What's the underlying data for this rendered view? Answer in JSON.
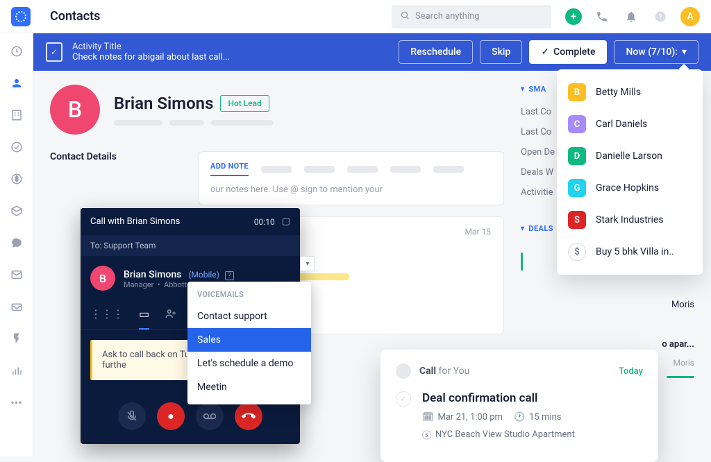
{
  "header": {
    "title": "Contacts",
    "search_placeholder": "Search anything",
    "avatar_letter": "A"
  },
  "activity": {
    "label": "Activity Title",
    "description": "Check notes for abigail about last call...",
    "reschedule": "Reschedule",
    "skip": "Skip",
    "complete": "Complete",
    "now": "Now (7/10):"
  },
  "contact": {
    "initial": "B",
    "name": "Brian Simons",
    "badge": "Hot Lead"
  },
  "details_title": "Contact Details",
  "note": {
    "tab": "ADD NOTE",
    "placeholder": "our notes here. Use @ sign to mention your"
  },
  "timeline": {
    "date": "Mar 15",
    "sticky": "Ask to call back on Tue discuss Proposal furthe"
  },
  "smartviews": {
    "title": "SMA",
    "items": [
      "Last Co",
      "Last Co",
      "Open De",
      "Deals W",
      "Activitie"
    ]
  },
  "deals": {
    "title": "DEALS",
    "items": [
      {
        "name": "Moris"
      },
      {
        "name": "o apar..."
      },
      {
        "sub": "Moris"
      }
    ]
  },
  "call": {
    "title": "Call with Brian Simons",
    "timer": "00:10",
    "to": "To: Support Team",
    "name": "Brian Simons",
    "channel": "(Mobile)",
    "role": "Manager",
    "company": "Abbott Inc."
  },
  "voicemail": {
    "heading": "VOICEMAILS",
    "items": [
      "Contact support",
      "Sales",
      "Let's schedule a demo",
      "Meetin"
    ],
    "selected_index": 1
  },
  "now_menu": [
    {
      "initial": "B",
      "color": "#fbbf24",
      "label": "Betty Mills"
    },
    {
      "initial": "C",
      "color": "#a78bfa",
      "label": "Carl Daniels"
    },
    {
      "initial": "D",
      "color": "#10b981",
      "label": "Danielle Larson"
    },
    {
      "initial": "G",
      "color": "#22d3ee",
      "label": "Grace Hopkins"
    },
    {
      "initial": "S",
      "color": "#dc2626",
      "label": "Stark Industries"
    },
    {
      "initial": "$",
      "color": "circle",
      "label": "Buy 5 bhk Villa in.."
    }
  ],
  "task": {
    "call_prefix": "Call",
    "call_for": "for You",
    "today": "Today",
    "title": "Deal confirmation call",
    "date": "Mar 21, 1:00 pm",
    "duration": "15 mins",
    "location": "NYC Beach View Studio Apartment"
  }
}
